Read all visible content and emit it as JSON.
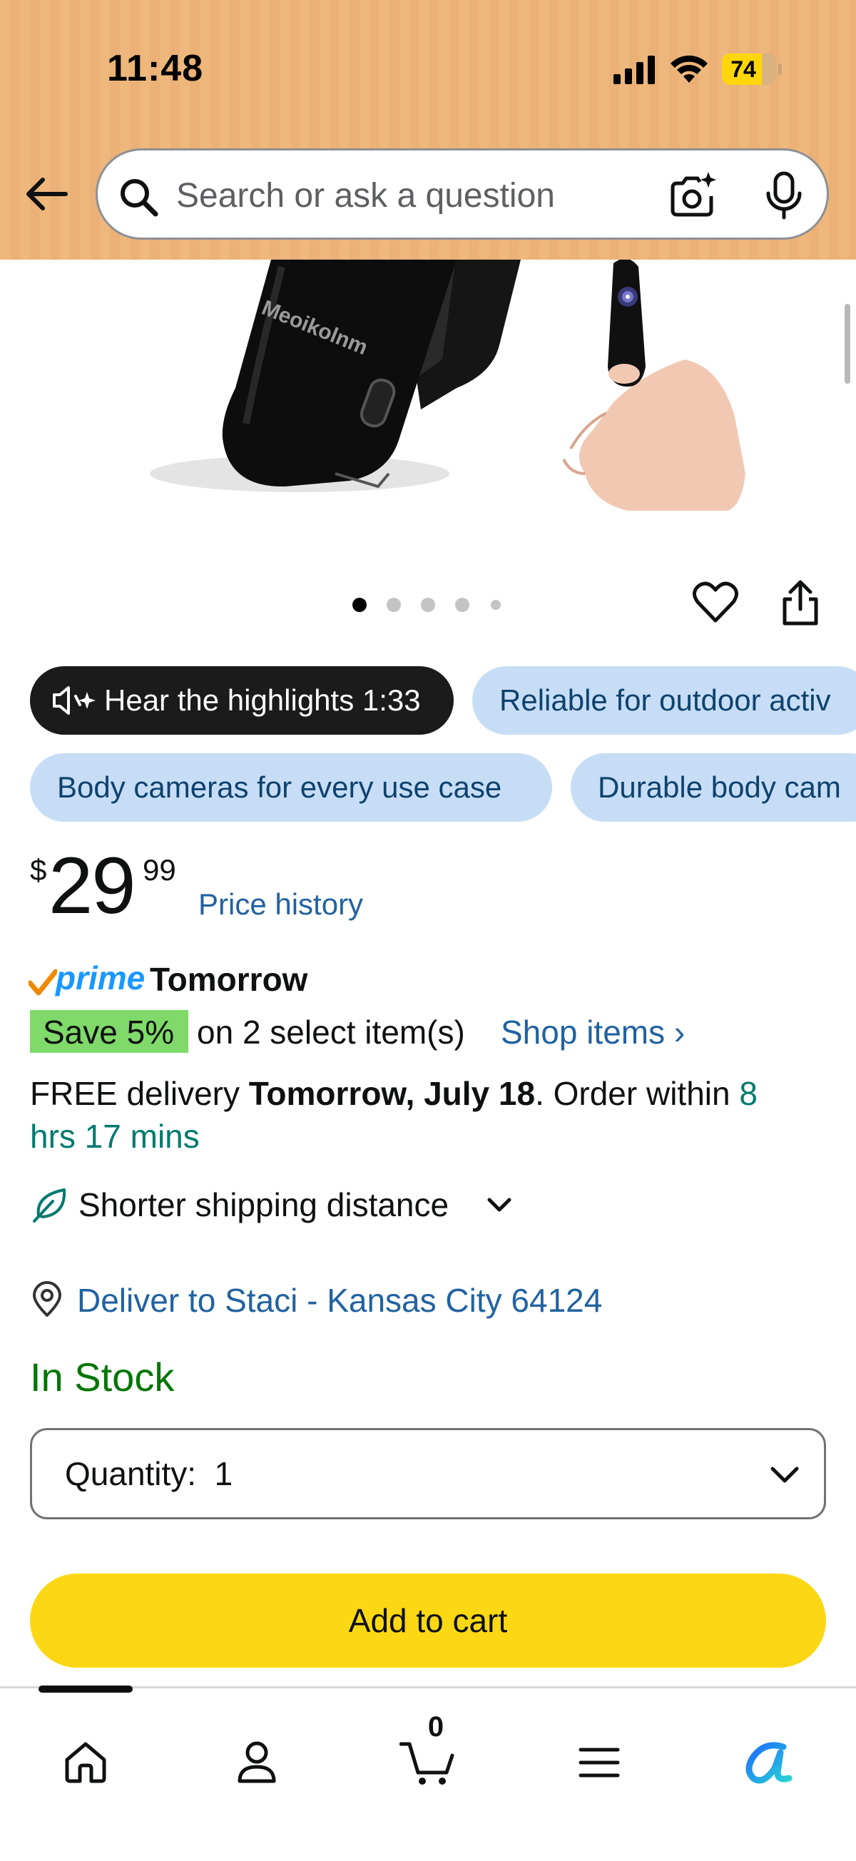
{
  "status_bar": {
    "time": "11:48",
    "battery_percent": "74",
    "battery_level": 0.74,
    "icons": [
      "cellular-signal-icon",
      "wifi-icon",
      "battery-icon"
    ]
  },
  "header": {
    "back_icon": "arrow-left-icon",
    "search_placeholder": "Search or ask a question",
    "icons": [
      "search-icon",
      "camera-search-icon",
      "microphone-icon"
    ],
    "background_color": "#eeb77c"
  },
  "product_image": {
    "brand_text": "Meoikolnm",
    "image_count": 5,
    "active_index": 0
  },
  "actions": {
    "icons": [
      "heart-icon",
      "share-icon"
    ]
  },
  "chips": {
    "hear_highlights": "Hear the highlights 1:33",
    "outdoor": "Reliable for outdoor activ",
    "use_case": "Body cameras for every use case",
    "durable": "Durable body cam"
  },
  "price": {
    "symbol": "$",
    "whole": "29",
    "fraction": "99",
    "history_link": "Price history"
  },
  "prime": {
    "logo_word": "prime",
    "delivery": "Tomorrow"
  },
  "promo": {
    "badge": "Save 5%",
    "text": "on 2 select item(s)",
    "link": "Shop items ›",
    "badge_color": "#7fda69"
  },
  "delivery": {
    "prefix": "FREE delivery ",
    "date": "Tomorrow, July 18",
    "middle": ". Order within ",
    "countdown_part1": "8",
    "countdown_part2": "hrs 17 mins"
  },
  "shipping": {
    "label": "Shorter shipping distance"
  },
  "location": {
    "text": "Deliver to Staci - Kansas City 64124"
  },
  "stock": {
    "status": "In Stock",
    "color": "#007600"
  },
  "quantity": {
    "label": "Quantity:",
    "value": "1"
  },
  "cart_button": {
    "label": "Add to cart",
    "color": "#fcd814"
  },
  "bottom_nav": {
    "items": [
      "home-icon",
      "account-icon",
      "cart-icon",
      "menu-icon",
      "rufus-icon"
    ],
    "cart_count": "0",
    "active": "home"
  }
}
